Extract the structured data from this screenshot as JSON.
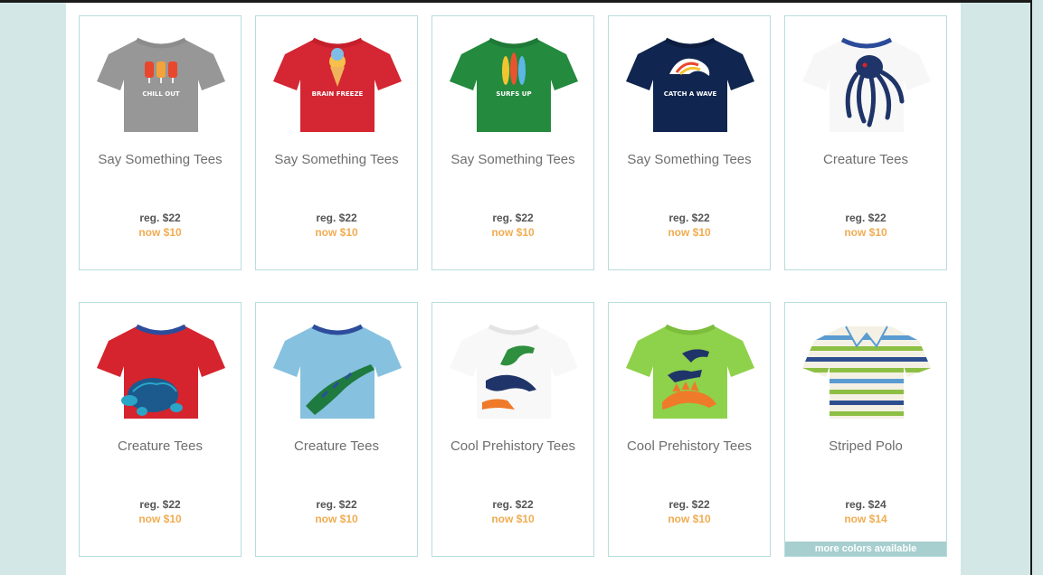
{
  "products": [
    {
      "name": "Say Something Tees",
      "regular": "reg. $22",
      "sale": "now $10",
      "color": "#979797",
      "collar": "#8c8c8c",
      "graphic": "popsicles",
      "graphic_text": "CHILL OUT",
      "image": "gray-tshirt"
    },
    {
      "name": "Say Something Tees",
      "regular": "reg. $22",
      "sale": "now $10",
      "color": "#d42633",
      "collar": "#c41f2b",
      "graphic": "icecream",
      "graphic_text": "BRAIN FREEZE",
      "image": "red-tshirt"
    },
    {
      "name": "Say Something Tees",
      "regular": "reg. $22",
      "sale": "now $10",
      "color": "#238a3e",
      "collar": "#1e7a36",
      "graphic": "surfboards",
      "graphic_text": "SURFS UP",
      "image": "green-tshirt"
    },
    {
      "name": "Say Something Tees",
      "regular": "reg. $22",
      "sale": "now $10",
      "color": "#10254f",
      "collar": "#0c1d40",
      "graphic": "wave",
      "graphic_text": "CATCH A WAVE",
      "image": "navy-tshirt"
    },
    {
      "name": "Creature Tees",
      "regular": "reg. $22",
      "sale": "now $10",
      "color": "#f7f7f7",
      "collar": "#2b4b9a",
      "graphic": "octopus",
      "graphic_text": "",
      "image": "white-octopus-tshirt"
    },
    {
      "name": "Creature Tees",
      "regular": "reg. $22",
      "sale": "now $10",
      "color": "#d5242e",
      "collar": "#2d4d9c",
      "graphic": "turtle",
      "graphic_text": "",
      "image": "red-turtle-tshirt"
    },
    {
      "name": "Creature Tees",
      "regular": "reg. $22",
      "sale": "now $10",
      "color": "#86c1df",
      "collar": "#2d4d9c",
      "graphic": "crocodile",
      "graphic_text": "",
      "image": "blue-crocodile-tshirt"
    },
    {
      "name": "Cool Prehistory Tees",
      "regular": "reg. $22",
      "sale": "now $10",
      "color": "#f8f8f8",
      "collar": "#e4e4e4",
      "graphic": "dinos",
      "graphic_text": "",
      "image": "white-dinosaur-tshirt"
    },
    {
      "name": "Cool Prehistory Tees",
      "regular": "reg. $22",
      "sale": "now $10",
      "color": "#8ed14a",
      "collar": "#7cbd3c",
      "graphic": "stegos",
      "graphic_text": "",
      "image": "lime-dinosaur-tshirt"
    },
    {
      "name": "Striped Polo",
      "regular": "reg. $24",
      "sale": "now $14",
      "color": "#f4f1e4",
      "collar": "#f4f1e4",
      "graphic": "stripes",
      "graphic_text": "",
      "image": "striped-polo",
      "badge": "more colors available"
    }
  ],
  "colors": {
    "sale": "#f0ac52",
    "border": "#b9dcdc",
    "page_bg": "#d4e7e7",
    "badge_bg": "#a7cfcf"
  }
}
